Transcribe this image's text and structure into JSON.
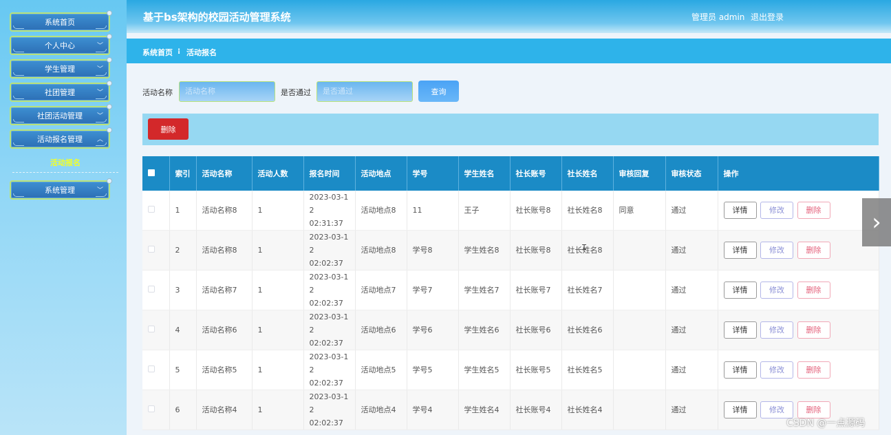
{
  "sidebar": {
    "menu": [
      {
        "label": "系统首页",
        "has_chevron": false
      },
      {
        "label": "个人中心",
        "has_chevron": true
      },
      {
        "label": "学生管理",
        "has_chevron": true
      },
      {
        "label": "社团管理",
        "has_chevron": true
      },
      {
        "label": "社团活动管理",
        "has_chevron": true
      },
      {
        "label": "活动报名管理",
        "has_chevron": true
      }
    ],
    "active_sub": "活动报名",
    "system_menu": "系统管理",
    "chevron_icon": "chevron-down-icon"
  },
  "header": {
    "title": "基于bs架构的校园活动管理系统",
    "user": "管理员 admin",
    "logout": "退出登录"
  },
  "breadcrumb": {
    "home": "系统首页",
    "separator": "⁝",
    "current": "活动报名"
  },
  "search": {
    "name_label": "活动名称",
    "name_placeholder": "活动名称",
    "pass_label": "是否通过",
    "pass_placeholder": "是否通过",
    "query_button": "查询"
  },
  "toolbar": {
    "delete_button": "删除"
  },
  "table": {
    "headers": [
      "",
      "索引",
      "活动名称",
      "活动人数",
      "报名时间",
      "活动地点",
      "学号",
      "学生姓名",
      "社长账号",
      "社长姓名",
      "审核回复",
      "审核状态",
      "操作"
    ],
    "rows": [
      {
        "idx": "1",
        "name": "活动名称8",
        "count": "1",
        "time_a": "2023-03-1",
        "time_b": "2 02:31:37",
        "place": "活动地点8",
        "sid": "11",
        "sname": "王子",
        "lacct": "社长账号8",
        "lname": "社长姓名8",
        "reply": "同意",
        "status": "通过"
      },
      {
        "idx": "2",
        "name": "活动名称8",
        "count": "1",
        "time_a": "2023-03-1",
        "time_b": "2 02:02:37",
        "place": "活动地点8",
        "sid": "学号8",
        "sname": "学生姓名8",
        "lacct": "社长账号8",
        "lname": "社长姓名8",
        "reply": "",
        "status": "通过"
      },
      {
        "idx": "3",
        "name": "活动名称7",
        "count": "1",
        "time_a": "2023-03-1",
        "time_b": "2 02:02:37",
        "place": "活动地点7",
        "sid": "学号7",
        "sname": "学生姓名7",
        "lacct": "社长账号7",
        "lname": "社长姓名7",
        "reply": "",
        "status": "通过"
      },
      {
        "idx": "4",
        "name": "活动名称6",
        "count": "1",
        "time_a": "2023-03-1",
        "time_b": "2 02:02:37",
        "place": "活动地点6",
        "sid": "学号6",
        "sname": "学生姓名6",
        "lacct": "社长账号6",
        "lname": "社长姓名6",
        "reply": "",
        "status": "通过"
      },
      {
        "idx": "5",
        "name": "活动名称5",
        "count": "1",
        "time_a": "2023-03-1",
        "time_b": "2 02:02:37",
        "place": "活动地点5",
        "sid": "学号5",
        "sname": "学生姓名5",
        "lacct": "社长账号5",
        "lname": "社长姓名5",
        "reply": "",
        "status": "通过"
      },
      {
        "idx": "6",
        "name": "活动名称4",
        "count": "1",
        "time_a": "2023-03-1",
        "time_b": "2 02:02:37",
        "place": "活动地点4",
        "sid": "学号4",
        "sname": "学生姓名4",
        "lacct": "社长账号4",
        "lname": "社长姓名4",
        "reply": "",
        "status": "通过"
      }
    ],
    "actions": {
      "detail": "详情",
      "edit": "修改",
      "delete": "删除"
    }
  },
  "pager": {
    "next": "›",
    "next_icon": "chevron-right-icon"
  },
  "watermark": "CSDN @一点源码",
  "colors": {
    "header": "#2aa8e2",
    "table_header": "#1b8bc6",
    "danger": "#d3282a",
    "query": "#4aa3f5",
    "active_sub": "#f2ff2a"
  }
}
